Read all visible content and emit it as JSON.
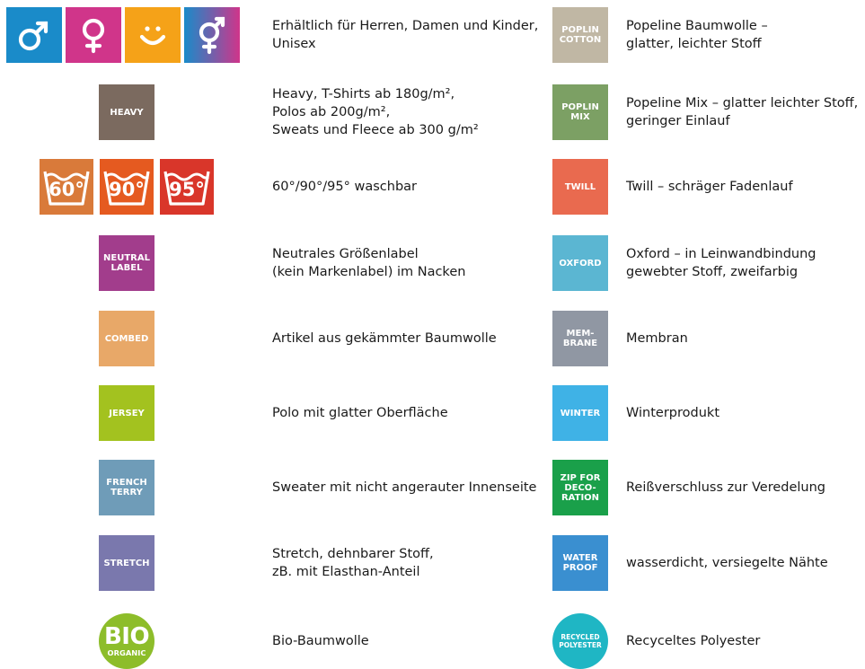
{
  "left": [
    {
      "type": "gender",
      "icons": [
        {
          "name": "male-icon",
          "color": "#1a8bc9",
          "glyph": "♂"
        },
        {
          "name": "female-icon",
          "color": "#d0358a",
          "glyph": "♀"
        },
        {
          "name": "kids-smiley-icon",
          "color": "#f5a218",
          "glyph": "☺"
        },
        {
          "name": "unisex-icon",
          "color": "#7b5ca8",
          "glyph": "⚥"
        }
      ],
      "text": "Erhältlich für Herren, Damen und Kinder,\nUnisex"
    },
    {
      "type": "badge",
      "label": "HEAVY",
      "color": "#7b6a5f",
      "text": "Heavy, T-Shirts ab 180g/m²,\nPolos ab 200g/m²,\nSweats und Fleece ab 300 g/m²"
    },
    {
      "type": "wash",
      "icons": [
        {
          "label": "60°",
          "color": "#d97a3a"
        },
        {
          "label": "90°",
          "color": "#e55a20"
        },
        {
          "label": "95°",
          "color": "#d9362a"
        }
      ],
      "text": "60°/90°/95° waschbar"
    },
    {
      "type": "badge",
      "label": "NEUTRAL\nLABEL",
      "color": "#a23d8c",
      "text": "Neutrales Größenlabel\n(kein Markenlabel) im Nacken"
    },
    {
      "type": "badge",
      "label": "COMBED",
      "color": "#e8a868",
      "text": "Artikel aus gekämmter Baumwolle"
    },
    {
      "type": "badge",
      "label": "JERSEY",
      "color": "#a3c21f",
      "text": "Polo mit glatter Oberfläche"
    },
    {
      "type": "badge",
      "label": "FRENCH\nTERRY",
      "color": "#6f9cb8",
      "text": "Sweater mit nicht angerauter Innenseite"
    },
    {
      "type": "badge",
      "label": "STRETCH",
      "color": "#7a78ad",
      "text": "Stretch, dehnbarer Stoff,\nzB. mit Elasthan-Anteil"
    },
    {
      "type": "round",
      "label": "BIO",
      "sublabel": "ORGANIC",
      "color": "#8dbd2a",
      "text": "Bio-Baumwolle"
    }
  ],
  "right": [
    {
      "label": "POPLIN\nCOTTON",
      "color": "#c0b7a4",
      "text": "Popeline Baumwolle –\nglatter, leichter Stoff"
    },
    {
      "label": "POPLIN\nMIX",
      "color": "#7ca064",
      "text": "Popeline Mix – glatter leichter Stoff,\ngeringer Einlauf"
    },
    {
      "label": "TWILL",
      "color": "#e96a4f",
      "text": "Twill – schräger Fadenlauf"
    },
    {
      "label": "OXFORD",
      "color": "#5bb6d2",
      "text": "Oxford – in Leinwandbindung\ngewebter Stoff, zweifarbig"
    },
    {
      "label": "MEM-\nBRANE",
      "color": "#9097a3",
      "text": "Membran"
    },
    {
      "label": "WINTER",
      "color": "#3fb2e6",
      "text": "Winterprodukt"
    },
    {
      "label": "ZIP FOR\nDECO-\nRATION",
      "color": "#1aa04a",
      "text": "Reißverschluss zur Veredelung"
    },
    {
      "label": "WATER\nPROOF",
      "color": "#3a8fd0",
      "text": "wasserdicht, versiegelte Nähte"
    },
    {
      "label": "RECYCLED\nPOLYESTER",
      "color": "#1fb6c4",
      "round": true,
      "text": "Recyceltes Polyester"
    }
  ]
}
